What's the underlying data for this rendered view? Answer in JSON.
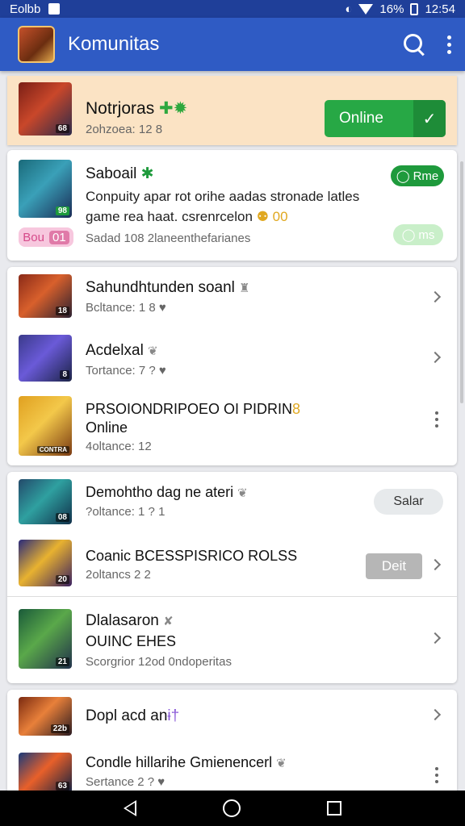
{
  "status_bar": {
    "carrier": "Eolbb",
    "battery": "16%",
    "time": "12:54"
  },
  "app_bar": {
    "title": "Komunitas",
    "logo_icon": "game-logo",
    "search_icon": "search-icon",
    "menu_icon": "more-vert-icon"
  },
  "featured": {
    "name": "Notrjoras",
    "emoji": "✚✹",
    "sub": "2ohzoea: 12 8",
    "thumb_tag": "68",
    "button": "Online",
    "button_check": "✓"
  },
  "highlight_card": {
    "name": "Saboail",
    "badge": "✱",
    "line1": "Conpuity apar rot orihe aadas stronade latles",
    "line2": "game rea haat. csrenrcelon",
    "line2_emoji": "⚉ 00",
    "meta": "Sadad 108 2laneenthefarianes",
    "thumb_tag": "98",
    "pill_top": "Rme",
    "pill_bottom": "ms",
    "pill_left": "Bou",
    "pill_left_count": "01",
    "accent": "#1e9a3c"
  },
  "group1": [
    {
      "name": "Sahundhtunden soanl",
      "icon": "♜",
      "sub": "Bcltance: 1 8 ♥",
      "tag": "18",
      "trail": "chevron"
    },
    {
      "name": "Acdelxal",
      "icon": "❦",
      "sub": "Tortance: 7 ? ♥",
      "tag": "8",
      "trail": "chevron"
    },
    {
      "name": "PRSOIONDRIPOEO OI PIDRIN",
      "icon": "8",
      "name2": "Online",
      "sub": "4oltance: 12",
      "tag": "CONTRA",
      "trail": "more"
    }
  ],
  "group2": [
    {
      "name": "Demohtho dag ne ateri",
      "icon": "❦",
      "sub": "?oltance: 1 ? 1",
      "tag": "08",
      "trail_btn": "Salar"
    },
    {
      "name": "Coanic BCESSPISRICO ROLSS",
      "sub": "2oltancs 2 2",
      "tag": "20",
      "trail_btn": "Deit",
      "trail": "chevron"
    },
    {
      "name": "Dlalasaron",
      "icon": "✘",
      "name2": "OUINC EHES",
      "sub": "Scorgrior 12od 0ndoperitas",
      "tag": "21",
      "trail": "chevron"
    }
  ],
  "group3": [
    {
      "name": "Dopl acd an",
      "icon": "ɨ†",
      "tag": "22b",
      "trail": "chevron"
    },
    {
      "name": "Condle hillarihe Gmienencerl",
      "icon": "❦",
      "sub": "Sertance 2 ? ♥",
      "tag": "63",
      "trail": "more"
    }
  ],
  "nav": {
    "back": "back-icon",
    "home": "home-icon",
    "recent": "recent-apps-icon"
  }
}
